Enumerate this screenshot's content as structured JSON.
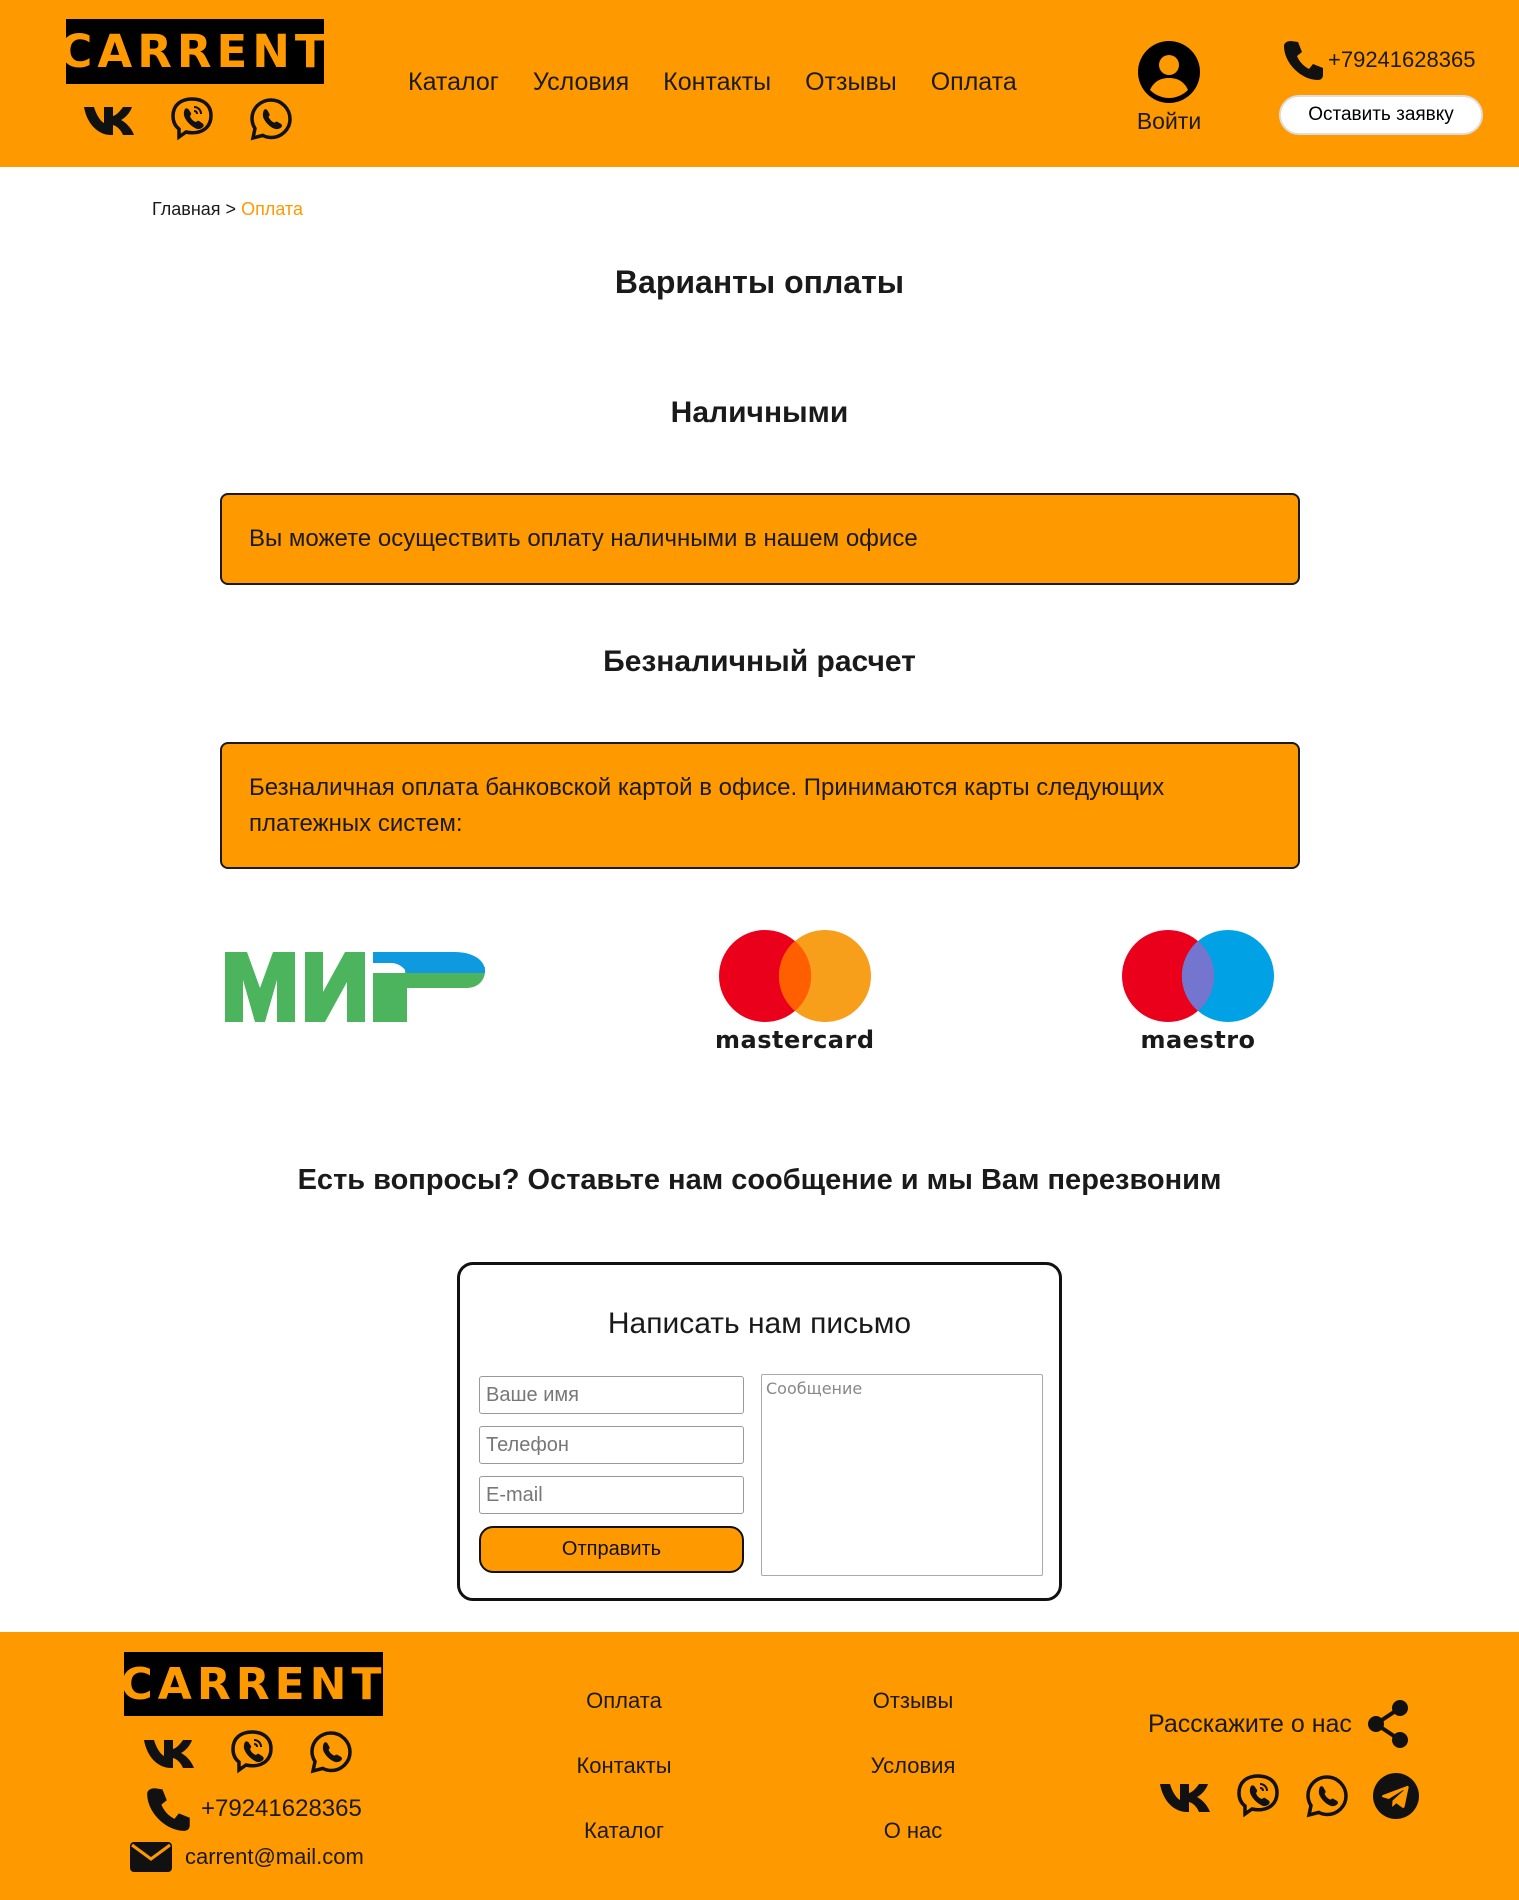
{
  "brand": {
    "logo_text": "CARRENT"
  },
  "header": {
    "nav": [
      "Каталог",
      "Условия",
      "Контакты",
      "Отзывы",
      "Оплата"
    ],
    "login_label": "Войти",
    "phone": "+79241628365",
    "request_label": "Оставить заявку"
  },
  "breadcrumb": {
    "home": "Главная",
    "separator": ">",
    "current": "Оплата"
  },
  "page": {
    "title": "Варианты оплаты",
    "cash_title": "Наличными",
    "cash_text": "Вы можете осуществить оплату наличными в нашем офисе",
    "card_title": "Безналичный расчет",
    "card_text": "Безналичная оплата банковской картой в офисе. Принимаются карты следующих платежных систем:",
    "payment_systems": {
      "mir": "МИР",
      "mastercard": "mastercard",
      "maestro": "maestro"
    },
    "questions": "Есть вопросы? Оставьте нам сообщение и мы Вам перезвоним"
  },
  "form": {
    "title": "Написать нам письмо",
    "name_placeholder": "Ваше имя",
    "phone_placeholder": "Телефон",
    "email_placeholder": "E-mail",
    "message_placeholder": "Сообщение",
    "submit_label": "Отправить"
  },
  "footer": {
    "phone": "+79241628365",
    "email": "carrent@mail.com",
    "links_col1": [
      "Оплата",
      "Контакты",
      "Каталог"
    ],
    "links_col2": [
      "Отзывы",
      "Условия",
      "О нас"
    ],
    "share_label": "Расскажите о нас"
  },
  "colors": {
    "accent": "#ff9900",
    "dark": "#000000",
    "mir_green": "#4db45e",
    "mir_blue": "#0f9ae0",
    "mc_red": "#eb001b",
    "mc_orange": "#f79e1b",
    "maestro_blue": "#00a2e5"
  },
  "icons": [
    "vk-icon",
    "viber-icon",
    "whatsapp-icon",
    "telegram-icon",
    "phone-icon",
    "user-icon",
    "mail-icon",
    "share-icon"
  ]
}
